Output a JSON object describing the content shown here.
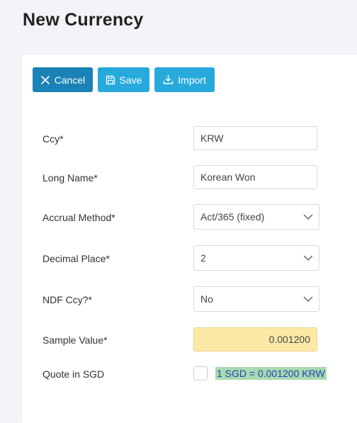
{
  "page": {
    "title": "New Currency"
  },
  "toolbar": {
    "cancel_label": "Cancel",
    "save_label": "Save",
    "import_label": "Import"
  },
  "form": {
    "ccy": {
      "label": "Ccy*",
      "value": "KRW"
    },
    "long_name": {
      "label": "Long Name*",
      "value": "Korean Won"
    },
    "accrual_method": {
      "label": "Accrual Method*",
      "value": "Act/365 (fixed)"
    },
    "decimal_place": {
      "label": "Decimal Place*",
      "value": "2"
    },
    "ndf_ccy": {
      "label": "NDF Ccy?*",
      "value": "No"
    },
    "sample_value": {
      "label": "Sample Value*",
      "value": "0.001200"
    },
    "quote_in_sgd": {
      "label": "Quote in SGD",
      "checked": false,
      "text": "1 SGD = 0.001200 KRW"
    }
  },
  "colors": {
    "primary_button": "#1a82b6",
    "secondary_button": "#27a9dc",
    "sample_highlight": "#fde9a6",
    "quote_highlight": "#a7dab0",
    "quote_text": "#2343b7"
  },
  "icons": {
    "cancel": "close-icon",
    "save": "save-icon",
    "import": "download-icon",
    "select": "chevron-down-icon"
  }
}
